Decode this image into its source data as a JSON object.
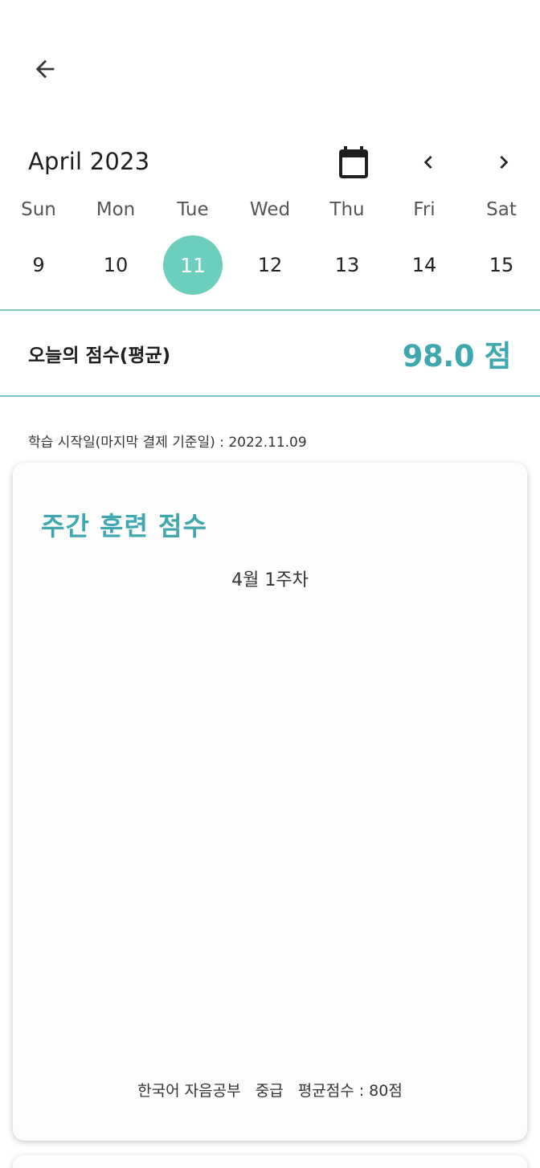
{
  "header": {
    "back_icon": "arrow-left-icon"
  },
  "calendar": {
    "month_label": "April 2023",
    "calendar_icon": "calendar-icon",
    "prev_icon": "chevron-left-icon",
    "next_icon": "chevron-right-icon",
    "weekdays": [
      "Sun",
      "Mon",
      "Tue",
      "Wed",
      "Thu",
      "Fri",
      "Sat"
    ],
    "dates": [
      "9",
      "10",
      "11",
      "12",
      "13",
      "14",
      "15"
    ],
    "selected_date": "11"
  },
  "today_score": {
    "label": "오늘의 점수(평균)",
    "value": "98.0 점"
  },
  "study_start": {
    "text": "학습 시작일(마지막 결제 기준일) : 2022.11.09"
  },
  "weekly_card": {
    "title": "주간 훈련 점수",
    "week_label": "4월 1주차",
    "footer": "한국어 자음공부   중급   평균점수 : 80점"
  },
  "colors": {
    "accent": "#3ea8ae",
    "selected_date_bg": "#6ccfbd",
    "divider": "#7ec4c6"
  }
}
